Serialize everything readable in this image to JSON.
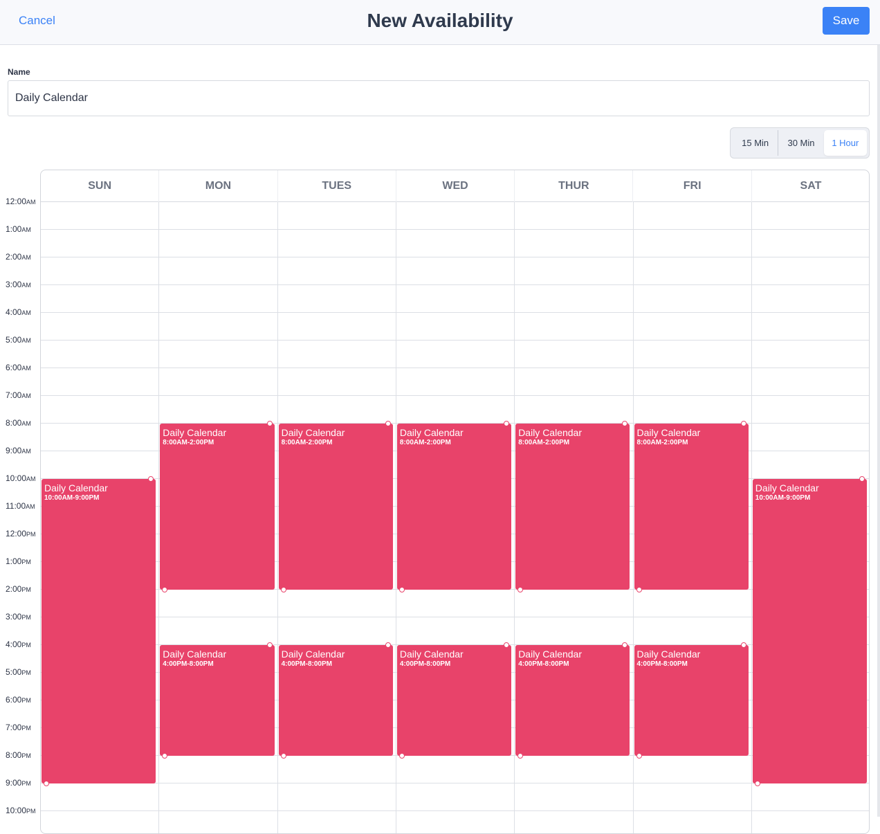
{
  "header": {
    "cancel_label": "Cancel",
    "title": "New Availability",
    "save_label": "Save"
  },
  "form": {
    "name_label": "Name",
    "name_value": "Daily Calendar"
  },
  "interval": {
    "options": [
      "15 Min",
      "30 Min",
      "1 Hour"
    ],
    "selected": "1 Hour"
  },
  "colors": {
    "accent": "#3b82f6",
    "event": "#e8436a"
  },
  "calendar": {
    "days": [
      "SUN",
      "MON",
      "TUES",
      "WED",
      "THUR",
      "FRI",
      "SAT"
    ],
    "hours": [
      {
        "t": "12:00",
        "p": "AM"
      },
      {
        "t": "1:00",
        "p": "AM"
      },
      {
        "t": "2:00",
        "p": "AM"
      },
      {
        "t": "3:00",
        "p": "AM"
      },
      {
        "t": "4:00",
        "p": "AM"
      },
      {
        "t": "5:00",
        "p": "AM"
      },
      {
        "t": "6:00",
        "p": "AM"
      },
      {
        "t": "7:00",
        "p": "AM"
      },
      {
        "t": "8:00",
        "p": "AM"
      },
      {
        "t": "9:00",
        "p": "AM"
      },
      {
        "t": "10:00",
        "p": "AM"
      },
      {
        "t": "11:00",
        "p": "AM"
      },
      {
        "t": "12:00",
        "p": "PM"
      },
      {
        "t": "1:00",
        "p": "PM"
      },
      {
        "t": "2:00",
        "p": "PM"
      },
      {
        "t": "3:00",
        "p": "PM"
      },
      {
        "t": "4:00",
        "p": "PM"
      },
      {
        "t": "5:00",
        "p": "PM"
      },
      {
        "t": "6:00",
        "p": "PM"
      },
      {
        "t": "7:00",
        "p": "PM"
      },
      {
        "t": "8:00",
        "p": "PM"
      },
      {
        "t": "9:00",
        "p": "PM"
      },
      {
        "t": "10:00",
        "p": "PM"
      }
    ],
    "events": [
      {
        "day": 0,
        "start": 10,
        "end": 21,
        "title": "Daily Calendar",
        "time": "10:00AM-9:00PM"
      },
      {
        "day": 1,
        "start": 8,
        "end": 14,
        "title": "Daily Calendar",
        "time": "8:00AM-2:00PM"
      },
      {
        "day": 2,
        "start": 8,
        "end": 14,
        "title": "Daily Calendar",
        "time": "8:00AM-2:00PM"
      },
      {
        "day": 3,
        "start": 8,
        "end": 14,
        "title": "Daily Calendar",
        "time": "8:00AM-2:00PM"
      },
      {
        "day": 4,
        "start": 8,
        "end": 14,
        "title": "Daily Calendar",
        "time": "8:00AM-2:00PM"
      },
      {
        "day": 5,
        "start": 8,
        "end": 14,
        "title": "Daily Calendar",
        "time": "8:00AM-2:00PM"
      },
      {
        "day": 1,
        "start": 16,
        "end": 20,
        "title": "Daily Calendar",
        "time": "4:00PM-8:00PM"
      },
      {
        "day": 2,
        "start": 16,
        "end": 20,
        "title": "Daily Calendar",
        "time": "4:00PM-8:00PM"
      },
      {
        "day": 3,
        "start": 16,
        "end": 20,
        "title": "Daily Calendar",
        "time": "4:00PM-8:00PM"
      },
      {
        "day": 4,
        "start": 16,
        "end": 20,
        "title": "Daily Calendar",
        "time": "4:00PM-8:00PM"
      },
      {
        "day": 5,
        "start": 16,
        "end": 20,
        "title": "Daily Calendar",
        "time": "4:00PM-8:00PM"
      },
      {
        "day": 6,
        "start": 10,
        "end": 21,
        "title": "Daily Calendar",
        "time": "10:00AM-9:00PM"
      }
    ]
  }
}
